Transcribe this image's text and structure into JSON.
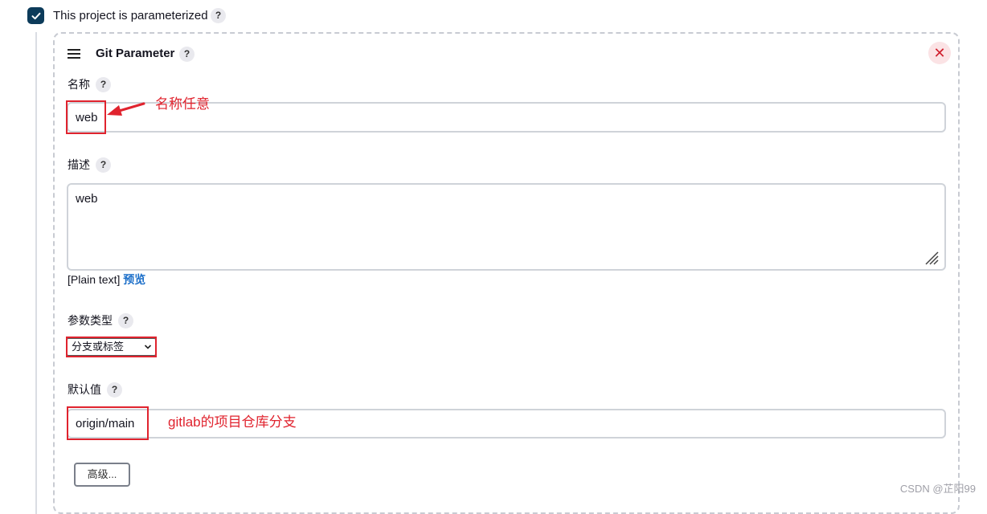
{
  "project": {
    "checkbox_label": "This project is parameterized",
    "checked": true
  },
  "git_parameter": {
    "title": "Git Parameter",
    "name_label": "名称",
    "name_value": "web",
    "description_label": "描述",
    "description_value": "web",
    "plain_text": "[Plain text]",
    "preview_link": "预览",
    "param_type_label": "参数类型",
    "param_type_selected": "分支或标签",
    "default_label": "默认值",
    "default_value": "origin/main",
    "advanced_button": "高级..."
  },
  "help_mark": "?",
  "close_mark": "✕",
  "annotations": {
    "name_note": "名称任意",
    "branch_note": "gitlab的项目仓库分支"
  },
  "watermark": "CSDN @芷阳99",
  "colors": {
    "checkbox": "#0c3b5a",
    "annotation_red": "#e0232e",
    "link_blue": "#1c6fc9",
    "close_bg": "#fbe3e5"
  },
  "icons": {
    "checkbox": "check-icon",
    "drag": "drag-handle-icon",
    "close": "close-icon",
    "help": "help-icon",
    "select": "chevron-down-icon",
    "resize": "resize-handle-icon",
    "arrow": "annotation-arrow-icon"
  }
}
